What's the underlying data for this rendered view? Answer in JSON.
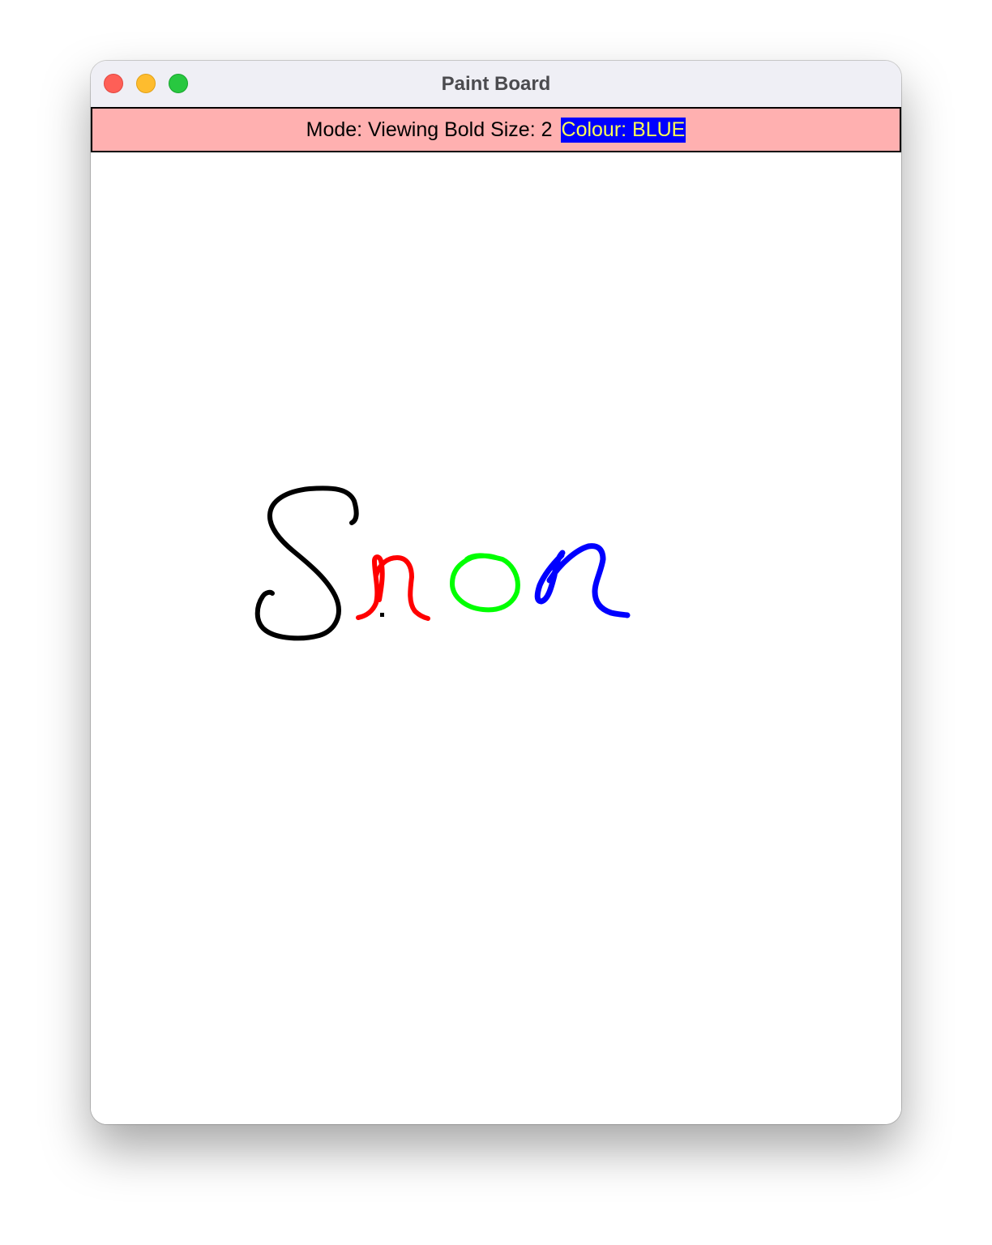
{
  "window": {
    "title": "Paint Board"
  },
  "status": {
    "text": "Mode: Viewing Bold Size: 2",
    "colour_label": "Colour: BLUE",
    "colour_chip_bg": "#0000ff",
    "colour_chip_fg": "#ffff55",
    "bar_bg": "#ffb0b0"
  },
  "drawing": {
    "strokes": [
      {
        "name": "black-s-stroke",
        "color": "#000000"
      },
      {
        "name": "red-n-stroke",
        "color": "#ff0000"
      },
      {
        "name": "green-o-stroke",
        "color": "#00ff00"
      },
      {
        "name": "blue-n-stroke",
        "color": "#0000ff"
      }
    ]
  }
}
